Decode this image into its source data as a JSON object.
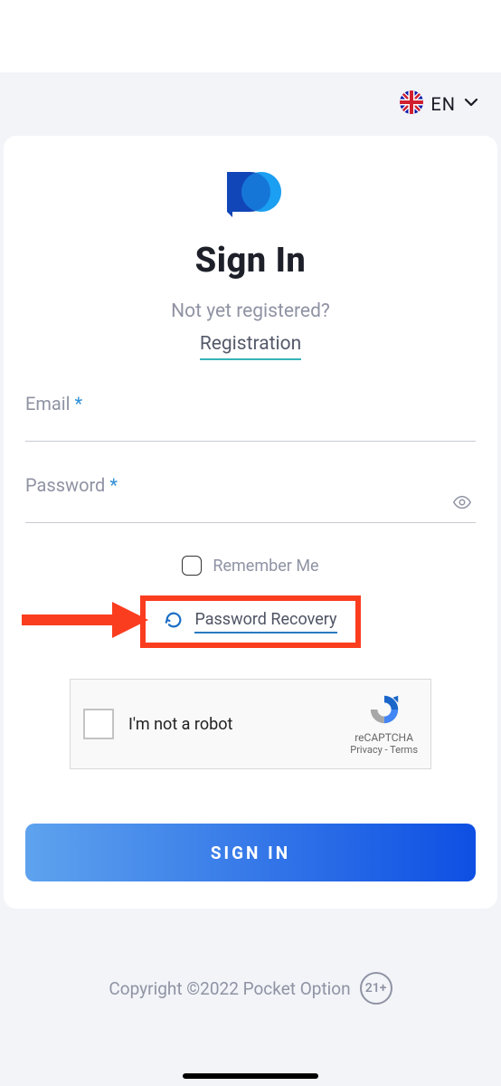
{
  "topbar": {
    "lang_label": "EN"
  },
  "page": {
    "title": "Sign In",
    "prompt": "Not yet registered?",
    "registration_link": "Registration"
  },
  "fields": {
    "email_label": "Email",
    "password_label": "Password",
    "required_mark": "*"
  },
  "remember": {
    "label": "Remember Me"
  },
  "recovery": {
    "link": "Password Recovery"
  },
  "captcha": {
    "text": "I'm not a robot",
    "brand": "reCAPTCHA",
    "links": "Privacy - Terms"
  },
  "actions": {
    "signin": "SIGN IN"
  },
  "footer": {
    "copyright": "Copyright ©2022 Pocket Option",
    "age": "21+"
  }
}
